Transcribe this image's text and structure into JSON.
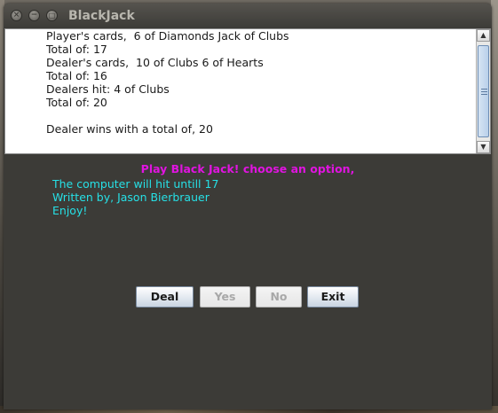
{
  "window": {
    "title": "BlackJack",
    "controls": {
      "close": "×",
      "minimize": "−",
      "maximize": "□"
    }
  },
  "output": {
    "lines": [
      "Player's cards,  6 of Diamonds Jack of Clubs",
      "Total of: 17",
      "Dealer's cards,  10 of Clubs 6 of Hearts",
      "Total of: 16",
      "Dealers hit: 4 of Clubs",
      "Total of: 20",
      "",
      "Dealer wins with a total of, 20"
    ],
    "scroll_up": "▲",
    "scroll_down": "▼"
  },
  "prompt": "Play Black Jack! choose an option,",
  "info": {
    "line1": "The computer will hit untill 17",
    "line2": "Written by, Jason Bierbrauer",
    "line3": "Enjoy!"
  },
  "buttons": {
    "deal": "Deal",
    "yes": "Yes",
    "no": "No",
    "exit": "Exit"
  },
  "colors": {
    "prompt": "#e014e0",
    "info": "#26e0e6",
    "window_bg": "#3c3b37"
  }
}
